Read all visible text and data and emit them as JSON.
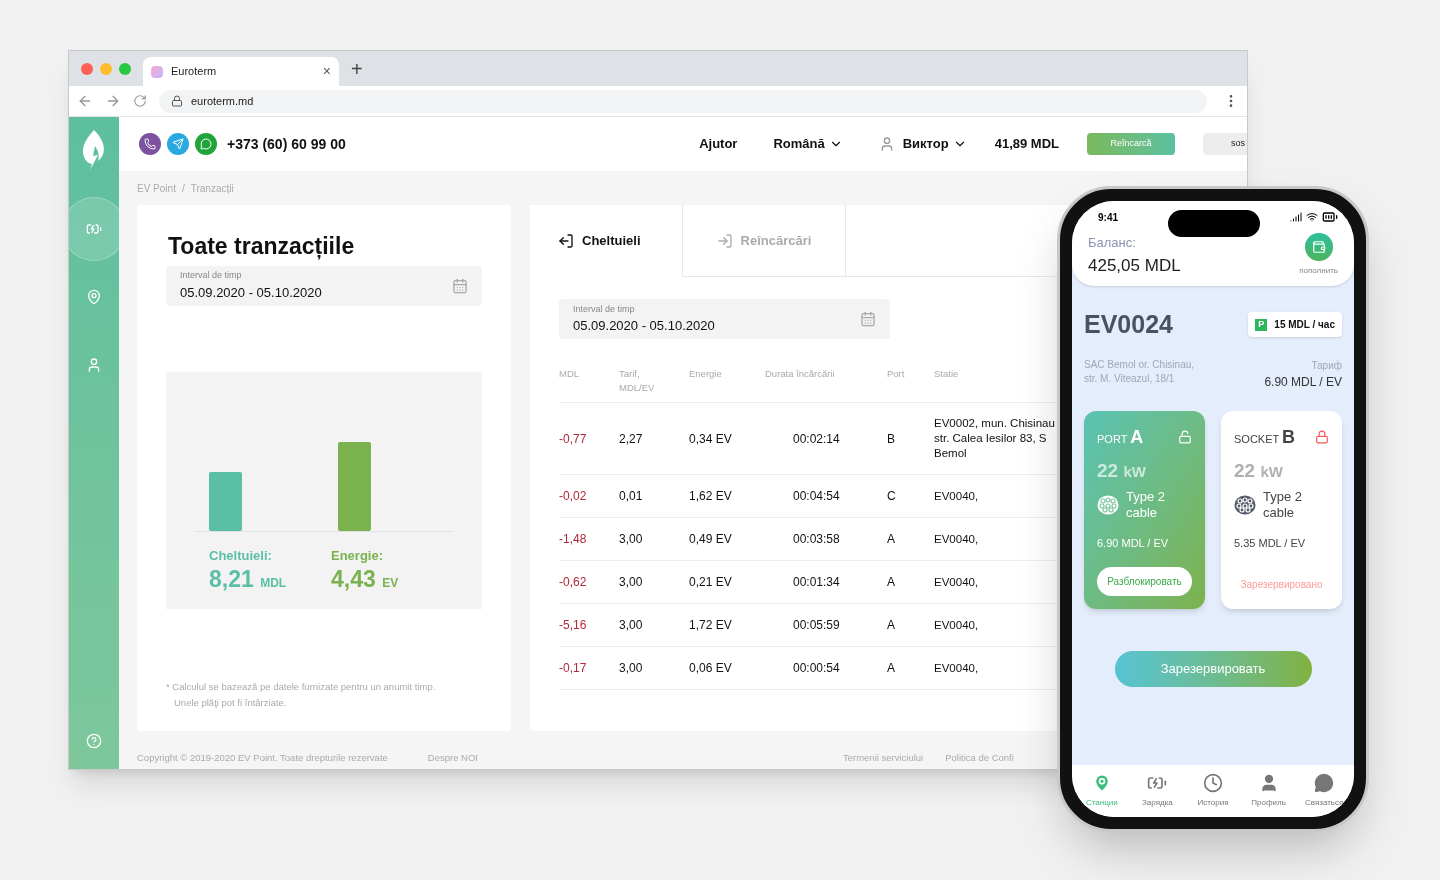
{
  "browser": {
    "tab_title": "Euroterm",
    "tab_close": "×",
    "new_tab": "+",
    "url": "euroterm.md"
  },
  "header": {
    "phone": "+373 (60) 60 99 00",
    "help": "Ajutor",
    "language": "Română",
    "user": "Виктор",
    "balance": "41,89 MDL",
    "topup_button": "Reîncarcă",
    "sos_button": "sos"
  },
  "sidebar": {
    "items": [
      {
        "kind": "charging",
        "selected": true
      },
      {
        "kind": "location",
        "selected": false
      },
      {
        "kind": "profile",
        "selected": false
      }
    ]
  },
  "breadcrumb": [
    "EV Point",
    "Tranzacții"
  ],
  "breadcrumb_separator": "/",
  "summary": {
    "title": "Toate tranzacțiile",
    "interval_label": "Interval de timp",
    "interval_value": "05.09.2020 - 05.10.2020",
    "stats": [
      {
        "label": "Cheltuieli:",
        "value": "8,21",
        "unit": "MDL",
        "color": "#5bbfa6"
      },
      {
        "label": "Energie:",
        "value": "4,43",
        "unit": "EV",
        "color": "#7ab24e"
      }
    ],
    "footnote_lines": [
      "* Calculul se bazează pe datele furnizate pentru un anumit timp.",
      "Unele plăţi pot fi întârziate."
    ]
  },
  "transactions": {
    "tabs": [
      {
        "label": "Cheltuieli",
        "selected": true
      },
      {
        "label": "Reîncărcări",
        "selected": false
      }
    ],
    "interval_label": "Interval de timp",
    "interval_value": "05.09.2020 - 05.10.2020",
    "columns": [
      "MDL",
      "Tarif, MDL/EV",
      "Energie",
      "Durata încărcării",
      "Port",
      "Statie"
    ],
    "rows": [
      {
        "amount": "-0,77",
        "tariff": "2,27",
        "energy": "0,34 EV",
        "duration": "00:02:14",
        "port": "B",
        "station": [
          "EV0002, mun. Chisinau",
          "str. Calea Iesilor 83, S",
          "Bemol"
        ]
      },
      {
        "amount": "-0,02",
        "tariff": "0,01",
        "energy": "1,62 EV",
        "duration": "00:04:54",
        "port": "C",
        "station": [
          "EV0040,"
        ]
      },
      {
        "amount": "-1,48",
        "tariff": "3,00",
        "energy": "0,49 EV",
        "duration": "00:03:58",
        "port": "A",
        "station": [
          "EV0040,"
        ]
      },
      {
        "amount": "-0,62",
        "tariff": "3,00",
        "energy": "0,21 EV",
        "duration": "00:01:34",
        "port": "A",
        "station": [
          "EV0040,"
        ]
      },
      {
        "amount": "-5,16",
        "tariff": "3,00",
        "energy": "1,72 EV",
        "duration": "00:05:59",
        "port": "A",
        "station": [
          "EV0040,"
        ]
      },
      {
        "amount": "-0,17",
        "tariff": "3,00",
        "energy": "0,06 EV",
        "duration": "00:00:54",
        "port": "A",
        "station": [
          "EV0040,"
        ]
      }
    ]
  },
  "footer": {
    "copyright": "Copyright © 2019-2020 EV Point. Toate drepturile rezervate",
    "links": [
      "Despre NOI",
      "Termenii serviciului",
      "Politica de Confi"
    ]
  },
  "phone": {
    "time": "9:41",
    "balance_label": "Баланс:",
    "balance": "425,05 MDL",
    "topup_label": "пополнить",
    "station_id": "EV0024",
    "parking_sign": "P",
    "parking_price": "15 MDL / час",
    "address_lines": [
      "SAC Bemol or. Chisinau,",
      "str. M. Viteazul, 18/1"
    ],
    "tariff_label": "Тариф",
    "tariff": "6.90 MDL / EV",
    "ports": [
      {
        "type_label": "PORT",
        "letter": "A",
        "power": "22",
        "unit": "kW",
        "connector": "Type 2 cable",
        "price": "6.90 MDL / EV",
        "action": "Разблокировать",
        "selected": true,
        "locked": false
      },
      {
        "type_label": "SOCKET",
        "letter": "B",
        "power": "22",
        "unit": "kW",
        "connector": "Type 2 cable",
        "price": "5.35 MDL / EV",
        "action": "Зарезервировано",
        "selected": false,
        "locked": true
      }
    ],
    "reserve_button": "Зарезервировать",
    "nav": [
      {
        "kind": "stations",
        "label": "Станции",
        "selected": true
      },
      {
        "kind": "charging",
        "label": "Зарядка",
        "selected": false
      },
      {
        "kind": "history",
        "label": "История",
        "selected": false
      },
      {
        "kind": "profile",
        "label": "Профиль",
        "selected": false
      },
      {
        "kind": "contact",
        "label": "Связаться",
        "selected": false
      }
    ]
  }
}
